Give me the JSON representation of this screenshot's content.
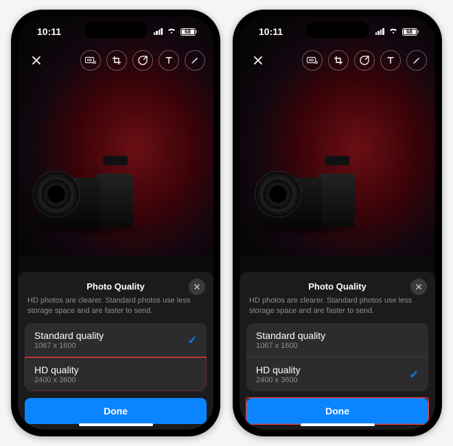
{
  "status": {
    "time": "10:11",
    "battery": "68"
  },
  "sheet": {
    "title": "Photo Quality",
    "description": "HD photos are clearer. Standard photos use less storage space and are faster to send.",
    "options": [
      {
        "label": "Standard quality",
        "sub": "1067 x 1600"
      },
      {
        "label": "HD quality",
        "sub": "2400 x 3600"
      }
    ],
    "done": "Done"
  },
  "phones": [
    {
      "selected": 0,
      "highlight": "option-1"
    },
    {
      "selected": 1,
      "highlight": "done"
    }
  ]
}
